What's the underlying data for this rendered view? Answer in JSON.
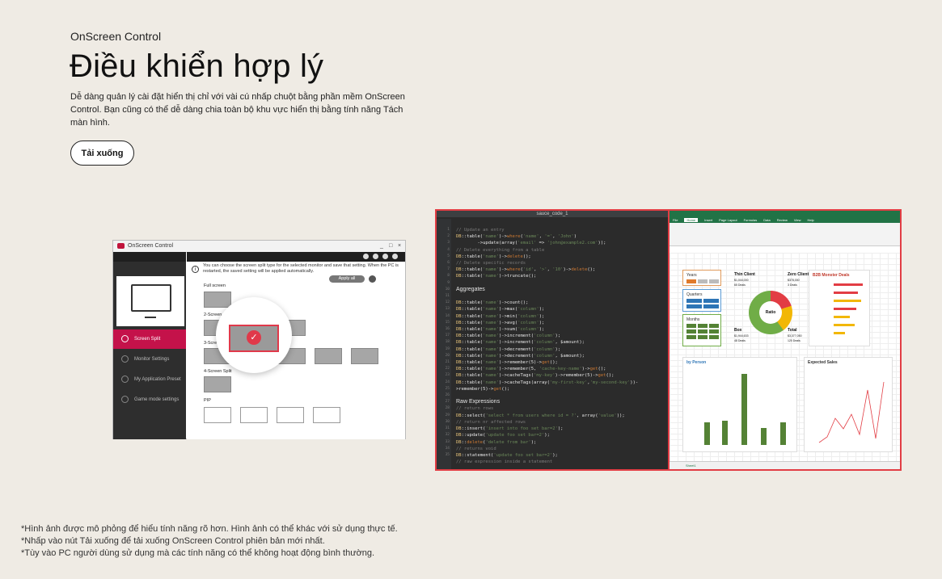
{
  "header": {
    "eyebrow": "OnScreen Control",
    "title": "Điều khiển hợp lý",
    "description": "Dễ dàng quản lý cài đặt hiển thị chỉ với vài cú nhấp chuột bằng phần mềm OnScreen Control. Bạn cũng có thể dễ dàng chia toàn bộ khu vực hiển thị bằng tính năng Tách màn hình.",
    "download_label": "Tải xuống"
  },
  "osc_window": {
    "title": "OnScreen Control",
    "window_controls": [
      "_",
      "□",
      "×"
    ],
    "info_text": "You can choose the screen split type for the selected monitor and save that setting. When the PC is restarted, the saved setting will be applied automatically.",
    "apply_label": "Apply all",
    "sections": [
      "Full screen",
      "2-Screen Split",
      "3-Screen Split",
      "4-Screen Split",
      "PIP"
    ],
    "sidebar_items": [
      {
        "label": "Screen Split",
        "active": true
      },
      {
        "label": "Monitor Settings",
        "active": false
      },
      {
        "label": "My Application Preset",
        "active": false
      },
      {
        "label": "Game mode settings",
        "active": false
      }
    ],
    "accent_color": "#c4124a"
  },
  "code_editor": {
    "tab_title": "sauce_code_1",
    "headings": [
      "Aggregates",
      "Raw Expressions"
    ]
  },
  "excel": {
    "cards": {
      "years": "Years",
      "quarters": "Quarters",
      "months": "Months",
      "thin_client": {
        "label": "Thin Client",
        "value": "$1,044,000",
        "deals": "65 Deals"
      },
      "zero_client": {
        "label": "Zero Client",
        "value": "$378,000",
        "deals": "3 Deals"
      },
      "box": {
        "label": "Box",
        "value": "$1,944,633",
        "deals": "48 Deals"
      },
      "total": {
        "label": "Total",
        "value": "$3,377,050",
        "deals": "120 Deals"
      },
      "ratio": "Ratio",
      "monster": "B2B Monster Deals",
      "by_person": "by Person",
      "expected_sales": "Expected Sales",
      "sheet_tab": "Sheet1"
    },
    "accent_color": "#217346"
  },
  "footnotes": [
    "*Hình ảnh được mô phỏng để hiểu tính năng rõ hơn. Hình ảnh có thể khác với sử dụng thực tế.",
    "*Nhấp vào nút Tải xuống để tải xuống OnScreen Control phiên bản mới nhất.",
    "*Tùy vào PC người dùng sử dụng mà các tính năng có thể không hoạt động bình thường."
  ]
}
